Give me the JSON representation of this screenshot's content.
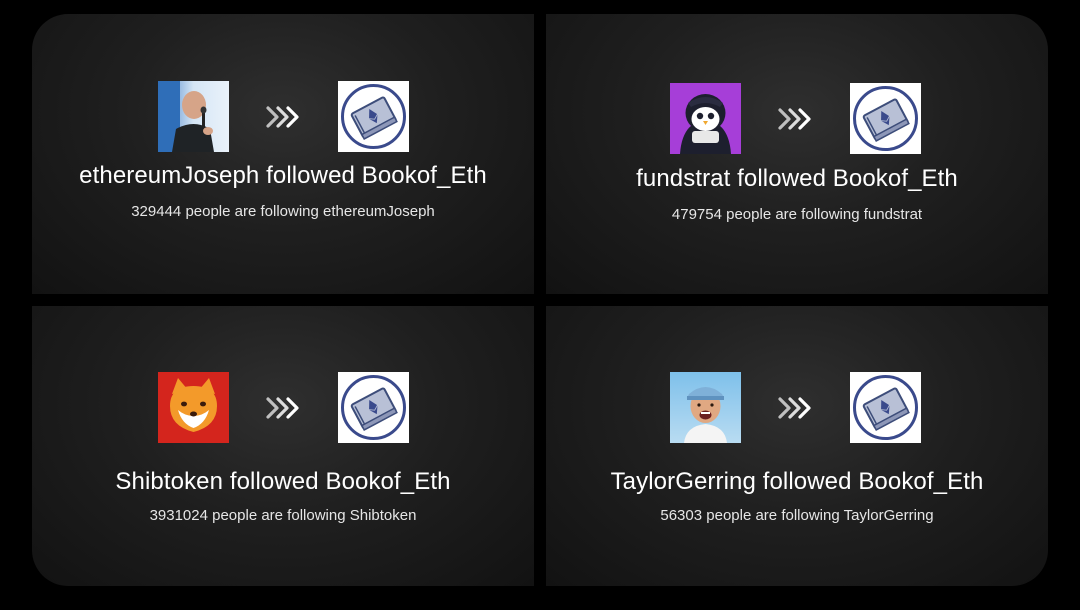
{
  "target_icon": "book-of-eth-logo-icon",
  "arrow_icon": "triple-chevron-right-icon",
  "cards": [
    {
      "avatar_icon": "ethereumjoseph-avatar",
      "title": "ethereumJoseph followed Bookof_Eth",
      "subtitle": "329444 people are following ethereumJoseph"
    },
    {
      "avatar_icon": "fundstrat-penguin-avatar",
      "title": "fundstrat followed Bookof_Eth",
      "subtitle": "479754 people are following fundstrat"
    },
    {
      "avatar_icon": "shiba-inu-avatar",
      "title": "Shibtoken followed Bookof_Eth",
      "subtitle": "3931024 people are following Shibtoken"
    },
    {
      "avatar_icon": "taylorgerring-avatar",
      "title": "TaylorGerring followed Bookof_Eth",
      "subtitle": "56303 people are following TaylorGerring"
    }
  ]
}
